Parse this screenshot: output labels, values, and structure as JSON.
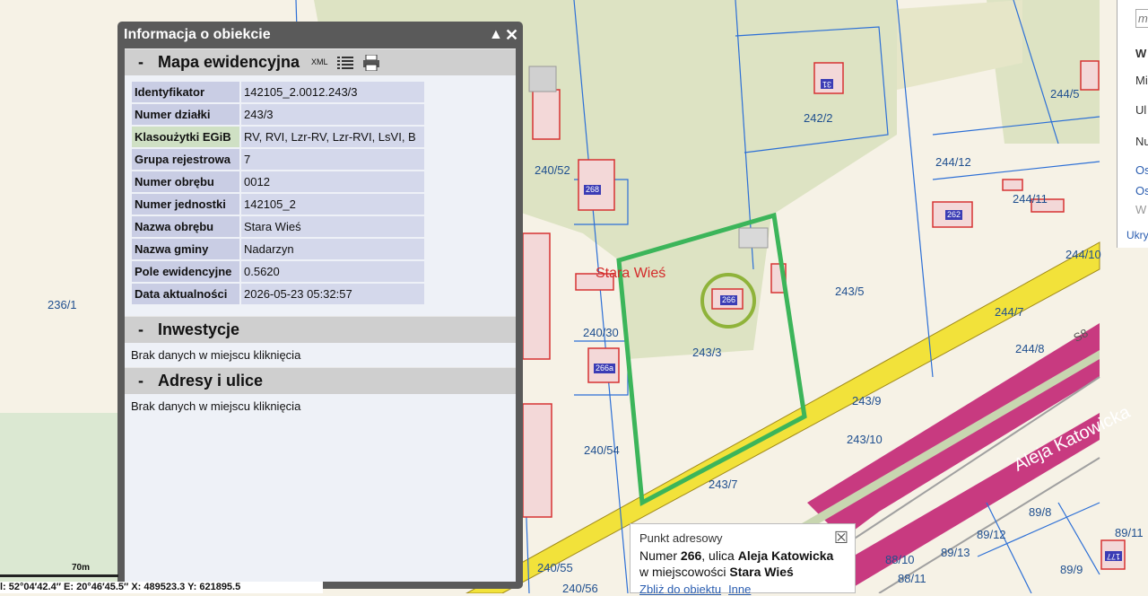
{
  "panel": {
    "title": "Informacja o obiekcie",
    "section_map": "Mapa ewidencyjna",
    "xml_label": "XML",
    "attributes": [
      {
        "key": "Identyfikator",
        "value": "142105_2.0012.243/3"
      },
      {
        "key": "Numer działki",
        "value": "243/3"
      },
      {
        "key": "Klasoużytki EGiB",
        "value": "RV, RVI, Lzr-RV, Lzr-RVI, LsVI, B"
      },
      {
        "key": "Grupa rejestrowa",
        "value": "7"
      },
      {
        "key": "Numer obrębu",
        "value": "0012"
      },
      {
        "key": "Numer jednostki",
        "value": "142105_2"
      },
      {
        "key": "Nazwa obrębu",
        "value": "Stara Wieś"
      },
      {
        "key": "Nazwa gminy",
        "value": "Nadarzyn"
      },
      {
        "key": "Pole ewidencyjne",
        "value": "0.5620"
      },
      {
        "key": "Data aktualności",
        "value": "2026-05-23 05:32:57"
      }
    ],
    "section_invest": "Inwestycje",
    "invest_msg": "Brak danych w miejscu kliknięcia",
    "section_addr": "Adresy i ulice",
    "addr_msg": "Brak danych w miejscu kliknięcia"
  },
  "popup": {
    "title": "Punkt adresowy",
    "line1_pre": "Numer ",
    "number": "266",
    "line1_mid": ", ulica ",
    "street": "Aleja Katowicka",
    "line2_pre": "w miejscowości ",
    "town": "Stara Wieś",
    "link_zoom": "Zbliż do obiektu",
    "link_other": "Inne"
  },
  "map": {
    "town_label": "Stara Wieś",
    "street_label": "Aleja Katowicka",
    "road_code": "S8",
    "parcels": [
      "236/1",
      "240/52",
      "240/30",
      "240/54",
      "240/55",
      "240/56",
      "243/3",
      "243/5",
      "243/7",
      "243/9",
      "243/10",
      "242/2",
      "244/12",
      "244/11",
      "244/5",
      "244/7",
      "244/8",
      "244/10",
      "89/12",
      "89/13",
      "89/8",
      "89/9",
      "88/10",
      "88/11",
      "89/11",
      "243/8"
    ],
    "buildings": [
      "268",
      "266",
      "266a",
      "262",
      "31",
      "177"
    ],
    "colors": {
      "parcel_border": "#2c6fd6",
      "building": "#d63232",
      "selected": "#3cb55a",
      "road_yellow": "#f2e23a",
      "road_pink": "#c83a80"
    }
  },
  "scale": {
    "label": "70m"
  },
  "coords": {
    "text": "l: 52°04′42.4″  E: 20°46′45.5″   X: 489523.3    Y: 621895.5"
  },
  "rpanel": {
    "items": [
      "m",
      "W",
      "Mi",
      "Ul",
      "Nu",
      "Os",
      "Os",
      "W",
      "Ukry"
    ]
  }
}
